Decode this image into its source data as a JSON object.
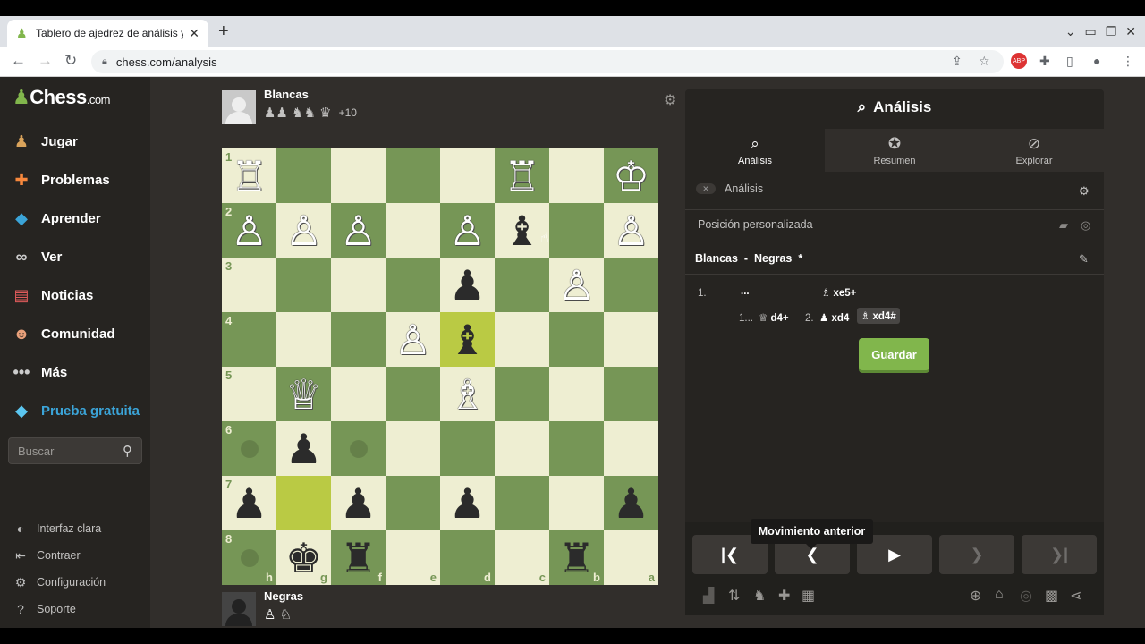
{
  "browser": {
    "tab_title": "Tablero de ajedrez de análisis y e",
    "url": "chess.com/analysis",
    "ext_badge": "ABP"
  },
  "sidebar": {
    "logo_main": "Chess",
    "logo_suffix": ".com",
    "items": [
      {
        "label": "Jugar",
        "icon": "pawn-play-icon"
      },
      {
        "label": "Problemas",
        "icon": "puzzle-icon"
      },
      {
        "label": "Aprender",
        "icon": "learn-icon"
      },
      {
        "label": "Ver",
        "icon": "binoculars-icon"
      },
      {
        "label": "Noticias",
        "icon": "news-icon"
      },
      {
        "label": "Comunidad",
        "icon": "community-icon"
      },
      {
        "label": "Más",
        "icon": "more-dots-icon"
      },
      {
        "label": "Prueba gratuita",
        "icon": "diamond-icon"
      }
    ],
    "search_placeholder": "Buscar",
    "sub_items": [
      {
        "label": "Interfaz clara",
        "icon": "half-moon-icon"
      },
      {
        "label": "Contraer",
        "icon": "collapse-icon"
      },
      {
        "label": "Configuración",
        "icon": "gear-icon"
      },
      {
        "label": "Soporte",
        "icon": "help-icon"
      }
    ]
  },
  "top_player": {
    "name": "Blancas",
    "captured": "♟♟ ♞♞ ♛",
    "advantage": "+10"
  },
  "bottom_player": {
    "name": "Negras",
    "captured": "♙ ♘"
  },
  "board": {
    "orientation": "black",
    "ranks": [
      "1",
      "2",
      "3",
      "4",
      "5",
      "6",
      "7",
      "8"
    ],
    "files": [
      "h",
      "g",
      "f",
      "e",
      "d",
      "c",
      "b",
      "a"
    ],
    "rows": [
      [
        "wR",
        "",
        "",
        "",
        "",
        "wR",
        "",
        "wK"
      ],
      [
        "wP",
        "wP",
        "wP",
        "",
        "wP",
        "bB",
        "",
        "wP"
      ],
      [
        "",
        "",
        "",
        "",
        "bP",
        "",
        "wP",
        ""
      ],
      [
        "",
        "",
        "",
        "wP",
        "bB",
        "",
        "",
        ""
      ],
      [
        "",
        "wQ",
        "",
        "",
        "wB",
        "",
        "",
        ""
      ],
      [
        "",
        "bP",
        "",
        "",
        "",
        "",
        "",
        ""
      ],
      [
        "bP",
        "",
        "bP",
        "",
        "bP",
        "",
        "",
        "bP"
      ],
      [
        "",
        "bK",
        "bR",
        "",
        "",
        "",
        "bR",
        ""
      ]
    ],
    "highlights": [
      [
        3,
        4
      ],
      [
        6,
        1
      ]
    ],
    "dots": [
      [
        5,
        0
      ],
      [
        5,
        2
      ],
      [
        7,
        0
      ]
    ]
  },
  "panel": {
    "title": "Análisis",
    "tabs": [
      {
        "label": "Análisis",
        "icon": "analysis-icon"
      },
      {
        "label": "Resumen",
        "icon": "star-icon"
      },
      {
        "label": "Explorar",
        "icon": "compass-icon"
      }
    ],
    "analysis_toggle_label": "Análisis",
    "position_label": "Posición personalizada",
    "players_line": "Blancas  -  Negras  *",
    "moves": {
      "row1_num": "1.",
      "row1_dots": "...",
      "row1_move": "xe5+",
      "row2_num1": "1...",
      "row2_move1": "d4+",
      "row2_num2": "2.",
      "row2_move2": "xd4",
      "row2_move3": "xd4#"
    },
    "save_label": "Guardar",
    "tooltip": "Movimiento anterior"
  }
}
